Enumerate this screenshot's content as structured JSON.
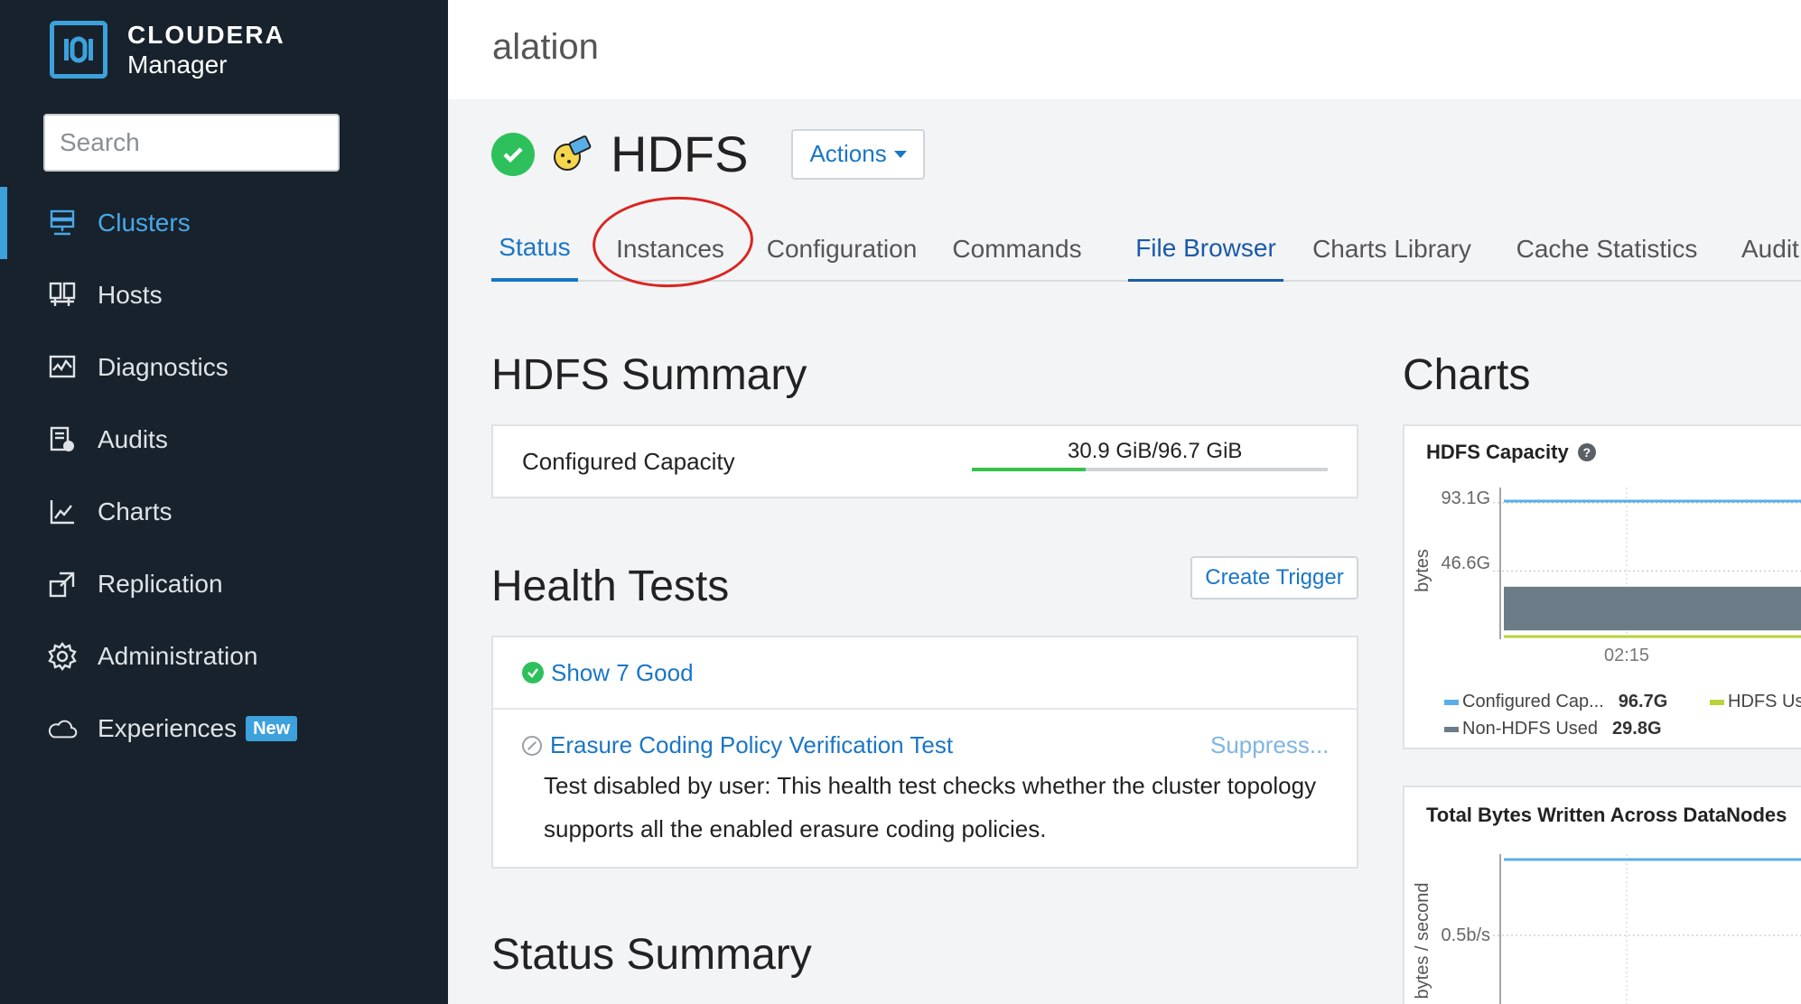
{
  "brand": {
    "name": "CLOUDERA",
    "product": "Manager"
  },
  "search": {
    "placeholder": "Search"
  },
  "nav": {
    "items": [
      {
        "label": "Clusters"
      },
      {
        "label": "Hosts"
      },
      {
        "label": "Diagnostics"
      },
      {
        "label": "Audits"
      },
      {
        "label": "Charts"
      },
      {
        "label": "Replication"
      },
      {
        "label": "Administration"
      },
      {
        "label": "Experiences",
        "badge": "New"
      }
    ],
    "active": "Clusters"
  },
  "cluster": {
    "name": "alation"
  },
  "service": {
    "name": "HDFS",
    "status": "good",
    "actions_label": "Actions"
  },
  "tabs": {
    "items": [
      {
        "label": "Status"
      },
      {
        "label": "Instances"
      },
      {
        "label": "Configuration"
      },
      {
        "label": "Commands"
      },
      {
        "label": "File Browser"
      },
      {
        "label": "Charts Library"
      },
      {
        "label": "Cache Statistics"
      },
      {
        "label": "Audit"
      }
    ],
    "active": "Status"
  },
  "summary": {
    "title": "HDFS Summary",
    "capacity_label": "Configured Capacity",
    "capacity_value": "30.9 GiB/96.7 GiB",
    "capacity_used_fraction": 0.32
  },
  "health": {
    "title": "Health Tests",
    "create_trigger_label": "Create Trigger",
    "show_good_label": "Show 7 Good",
    "test_name": "Erasure Coding Policy Verification Test",
    "suppress_label": "Suppress...",
    "test_description": "Test disabled by user: This health test checks whether the cluster topology supports all the enabled erasure coding policies."
  },
  "status_summary": {
    "title": "Status Summary"
  },
  "charts": {
    "title": "Charts",
    "capacity_chart": {
      "title": "HDFS Capacity",
      "ylabel": "bytes",
      "yticks": [
        "93.1G",
        "46.6G"
      ],
      "xticks": [
        "02:15"
      ],
      "legend": [
        {
          "label": "Configured Cap...",
          "value": "96.7G",
          "color": "#5aaee8"
        },
        {
          "label": "HDFS Us",
          "color": "#b9d33a"
        },
        {
          "label": "Non-HDFS Used",
          "value": "29.8G",
          "color": "#6b7c88"
        }
      ]
    },
    "bytes_chart": {
      "title": "Total Bytes Written Across DataNodes",
      "ylabel": "bytes / second",
      "yticks": [
        "0.5b/s"
      ]
    }
  },
  "chart_data": [
    {
      "type": "area",
      "title": "HDFS Capacity",
      "xlabel": "",
      "ylabel": "bytes",
      "xticks": [
        "02:15"
      ],
      "yticks": [
        "93.1G",
        "46.6G"
      ],
      "ylim_gib": [
        0,
        100
      ],
      "series": [
        {
          "name": "Configured Capacity",
          "value_gib": 96.7,
          "color": "#5aaee8"
        },
        {
          "name": "HDFS Used",
          "value_gib": 1.1,
          "color": "#b9d33a"
        },
        {
          "name": "Non-HDFS Used",
          "value_gib": 29.8,
          "color": "#6b7c88"
        }
      ]
    },
    {
      "type": "line",
      "title": "Total Bytes Written Across DataNodes",
      "ylabel": "bytes / second",
      "yticks": [
        "0.5b/s"
      ],
      "ylim": [
        0,
        1
      ],
      "series": [
        {
          "value": 1.0,
          "color": "#5aaee8"
        }
      ]
    }
  ]
}
